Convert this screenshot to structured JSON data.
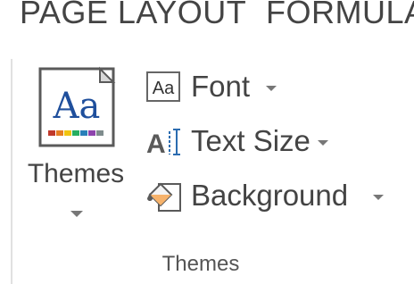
{
  "tabs": {
    "page_layout": "PAGE LAYOUT",
    "formulas": "FORMULA"
  },
  "themes_group": {
    "themes_button_label": "Themes",
    "group_label": "Themes",
    "themes_icon_text": "Aa",
    "commands": {
      "font": {
        "label": "Font",
        "icon_text": "Aa"
      },
      "text_size": {
        "label": "Text Size"
      },
      "background": {
        "label": "Background"
      }
    }
  },
  "colors": {
    "text": "#444444",
    "icon_blue": "#1f4f9c",
    "swatches": [
      "#c0392b",
      "#e67e22",
      "#f1c40f",
      "#27ae60",
      "#2980b9",
      "#8e44ad",
      "#7f8c8d",
      "#95a5a6"
    ]
  }
}
